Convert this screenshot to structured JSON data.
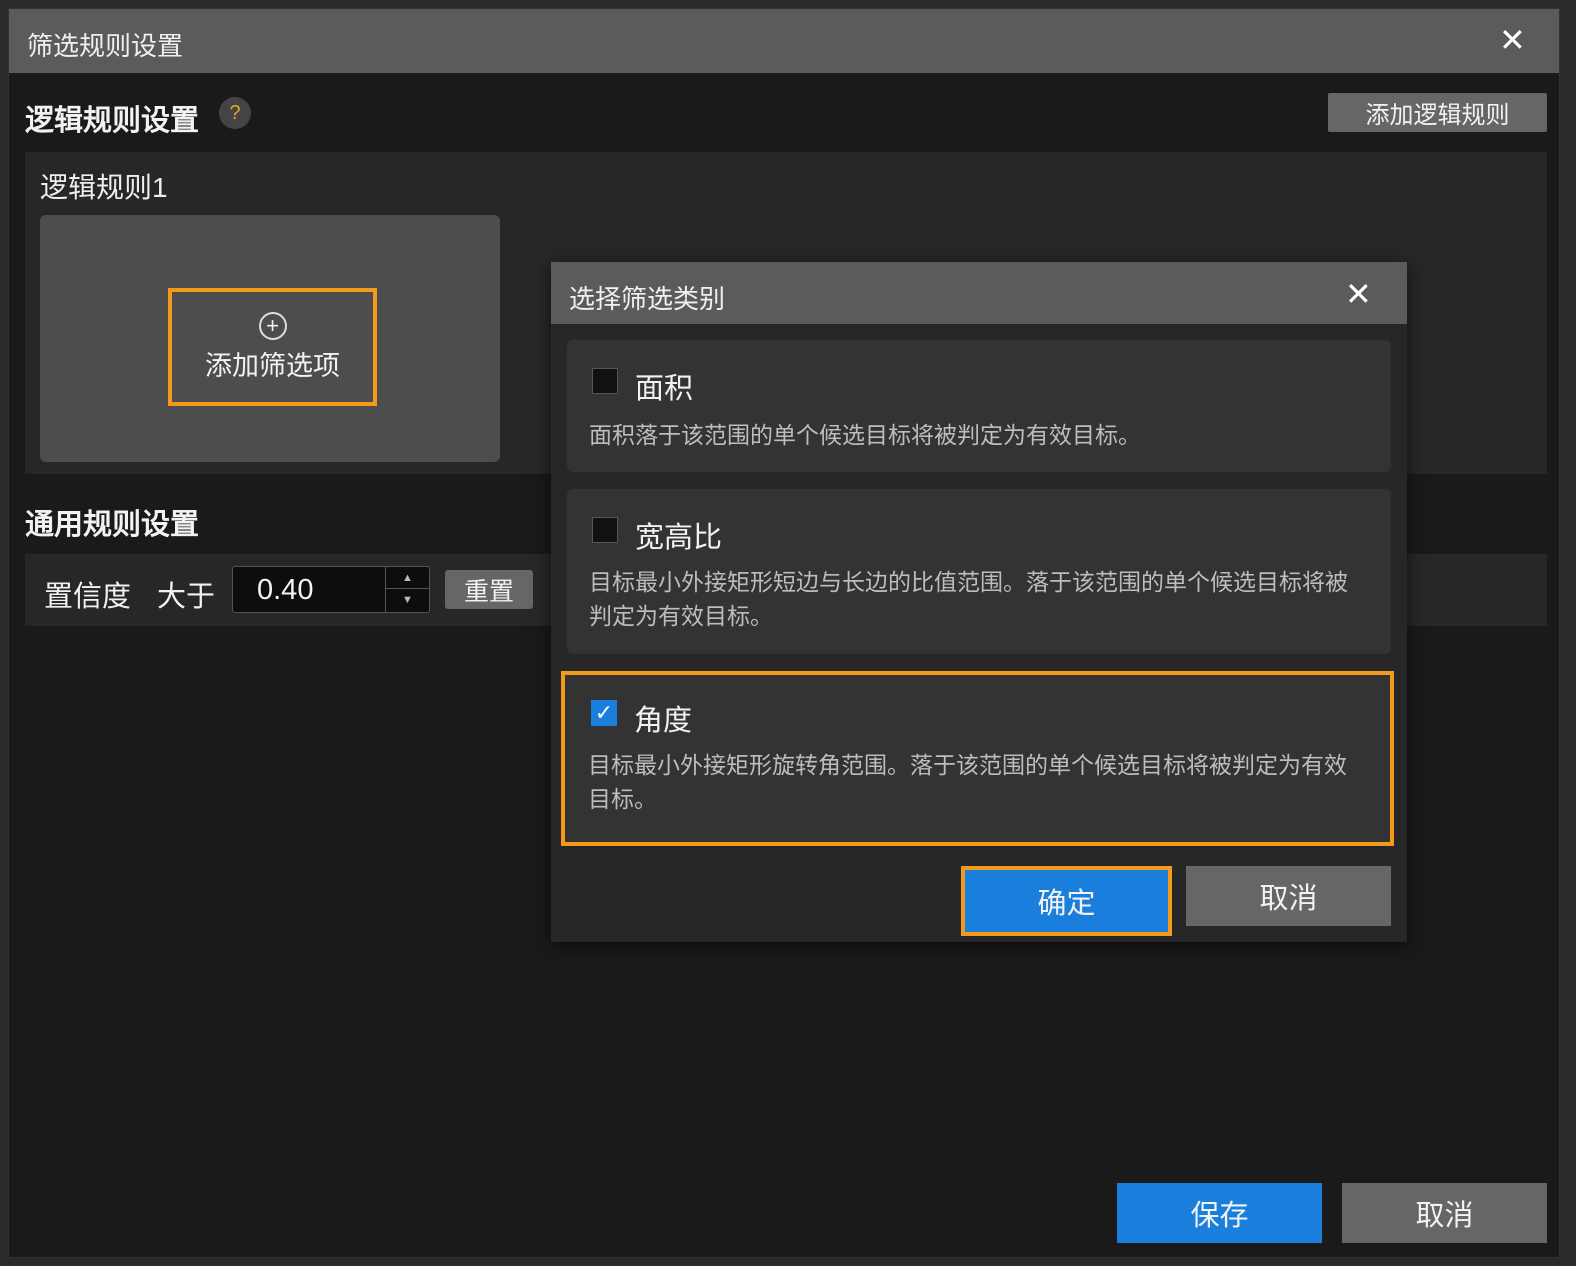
{
  "dialog": {
    "title": "筛选规则设置"
  },
  "logic": {
    "title": "逻辑规则设置",
    "help": "?",
    "add_rule": "添加逻辑规则",
    "rule_name": "逻辑规则1",
    "add_filter": "添加筛选项"
  },
  "general": {
    "title": "通用规则设置",
    "confidence_label": "置信度",
    "comparator": "大于",
    "value": "0.40",
    "reset": "重置"
  },
  "footer": {
    "save": "保存",
    "cancel": "取消"
  },
  "popup": {
    "title": "选择筛选类别",
    "confirm": "确定",
    "cancel": "取消",
    "items": [
      {
        "label": "面积",
        "checked": false,
        "desc": "面积落于该范围的单个候选目标将被判定为有效目标。"
      },
      {
        "label": "宽高比",
        "checked": false,
        "desc": "目标最小外接矩形短边与长边的比值范围。落于该范围的单个候选目标将被判定为有效目标。"
      },
      {
        "label": "角度",
        "checked": true,
        "desc": "目标最小外接矩形旋转角范围。落于该范围的单个候选目标将被判定为有效目标。"
      }
    ]
  },
  "colors": {
    "accent": "#1a7fdc",
    "highlight": "#f39a1d"
  }
}
